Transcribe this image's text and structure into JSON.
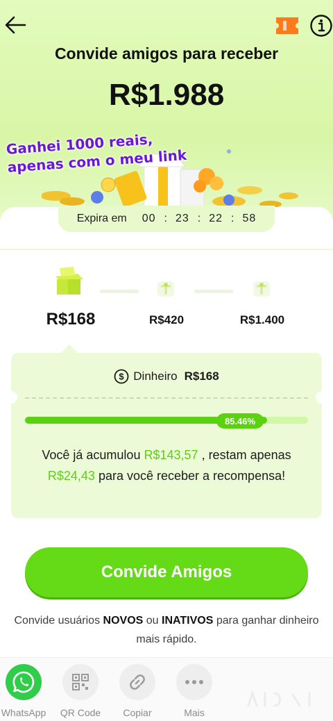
{
  "header": {
    "title": "Convide amigos para receber",
    "total_amount": "R$1.988"
  },
  "icons": {
    "back": "arrow-left-icon",
    "ticket": "ticket-icon",
    "info": "info-icon"
  },
  "overlay_caption": {
    "line1": "Ganhei 1000 reais,",
    "line2": "apenas com o meu link"
  },
  "expiry": {
    "label": "Expira em",
    "hours": "00",
    "minutes": "23",
    "seconds": "22",
    "frames": "58"
  },
  "steps": [
    {
      "amount": "R$168",
      "state": "current"
    },
    {
      "amount": "R$420",
      "state": "locked"
    },
    {
      "amount": "R$1.400",
      "state": "locked"
    }
  ],
  "reward": {
    "label": "Dinheiro",
    "amount": "R$168"
  },
  "progress": {
    "percent_label": "85.46%",
    "fraction": 0.8546,
    "msg_prefix": "Você já acumulou",
    "accumulated": "R$143,57",
    "msg_middle": ", restam apenas",
    "remaining": "R$24,43",
    "msg_suffix": "para você receber a recompensa!"
  },
  "cta": {
    "label": "Convide Amigos"
  },
  "note": {
    "prefix": "Convide usuários",
    "novos": "NOVOS",
    "ou": "ou",
    "inativos": "INATIVOS",
    "suffix": "para ganhar dinheiro mais rápido."
  },
  "share": [
    {
      "label": "WhatsApp",
      "icon": "whatsapp-icon"
    },
    {
      "label": "QR Code",
      "icon": "qr-code-icon"
    },
    {
      "label": "Copiar",
      "icon": "link-icon"
    },
    {
      "label": "Mais",
      "icon": "more-icon"
    }
  ],
  "colors": {
    "accent": "#64db16",
    "progress": "#5ad20f",
    "caption": "#6a18d6",
    "ticket": "#ff7a1a"
  }
}
